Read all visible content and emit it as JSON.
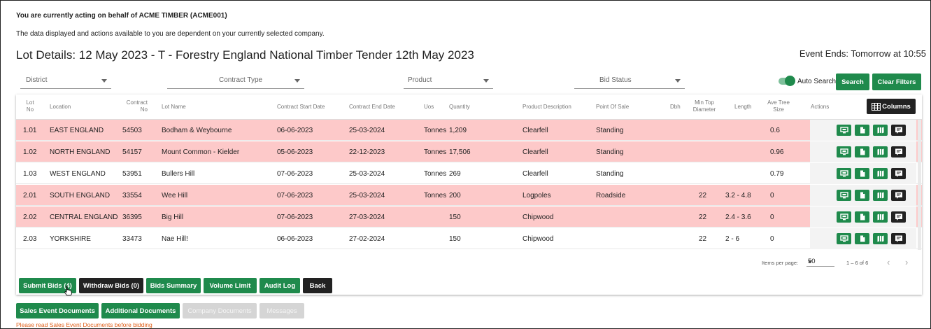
{
  "notice": {
    "acting_on_behalf": "You are currently acting on behalf of ACME TIMBER (ACME001)",
    "dependency": "The data displayed and actions available to you are dependent on your currently selected company."
  },
  "page": {
    "title": "Lot Details: 12 May 2023 - T - Forestry England National Timber Tender 12th May 2023",
    "event_ends": "Event Ends: Tomorrow at 10:55"
  },
  "filters": {
    "district": "District",
    "contract_type": "Contract Type",
    "product": "Product",
    "bid_status": "Bid Status",
    "auto_search_label": "Auto Search",
    "auto_search_on": true,
    "search_button": "Search",
    "clear_filters_button": "Clear Filters"
  },
  "table": {
    "headers": {
      "lot_no_1": "Lot",
      "lot_no_2": "No",
      "location": "Location",
      "contract_no_1": "Contract",
      "contract_no_2": "No",
      "lot_name": "Lot Name",
      "contract_start": "Contract Start Date",
      "contract_end": "Contract End Date",
      "uos": "Uos",
      "quantity": "Quantity",
      "product_description": "Product Description",
      "point_of_sale": "Point Of Sale",
      "dbh": "Dbh",
      "min_top_1": "Min Top",
      "min_top_2": "Diameter",
      "length": "Length",
      "ave_tree_1": "Ave Tree",
      "ave_tree_2": "Size",
      "actions": "Actions",
      "columns_button": "Columns"
    },
    "rows": [
      {
        "lot": "1.01",
        "location": "EAST ENGLAND",
        "contract": "54503",
        "name": "Bodham & Weybourne",
        "start": "06-06-2023",
        "end": "25-03-2024",
        "uos": "Tonnes",
        "qty": "1,209",
        "product": "Clearfell",
        "pos": "Standing",
        "dbh": "",
        "min_top": "",
        "length": "",
        "ave": "0.6",
        "highlight": true
      },
      {
        "lot": "1.02",
        "location": "NORTH ENGLAND",
        "contract": "54157",
        "name": "Mount Common - Kielder",
        "start": "05-06-2023",
        "end": "22-12-2023",
        "uos": "Tonnes",
        "qty": "17,506",
        "product": "Clearfell",
        "pos": "Standing",
        "dbh": "",
        "min_top": "",
        "length": "",
        "ave": "0.96",
        "highlight": true
      },
      {
        "lot": "1.03",
        "location": "WEST ENGLAND",
        "contract": "53951",
        "name": "Bullers Hill",
        "start": "07-06-2023",
        "end": "25-03-2024",
        "uos": "Tonnes",
        "qty": "269",
        "product": "Clearfell",
        "pos": "Standing",
        "dbh": "",
        "min_top": "",
        "length": "",
        "ave": "0.79",
        "highlight": false
      },
      {
        "lot": "2.01",
        "location": "SOUTH ENGLAND",
        "contract": "33554",
        "name": "Wee Hill",
        "start": "07-06-2023",
        "end": "25-03-2024",
        "uos": "Tonnes",
        "qty": "200",
        "product": "Logpoles",
        "pos": "Roadside",
        "dbh": "",
        "min_top": "22",
        "length": "3.2 - 4.8",
        "ave": "0",
        "highlight": true
      },
      {
        "lot": "2.02",
        "location": "CENTRAL ENGLAND",
        "contract": "36395",
        "name": "Big Hill",
        "start": "07-06-2023",
        "end": "27-03-2024",
        "uos": "",
        "qty": "150",
        "product": "Chipwood",
        "pos": "",
        "dbh": "",
        "min_top": "22",
        "length": "2.4 - 3.6",
        "ave": "0",
        "highlight": true
      },
      {
        "lot": "2.03",
        "location": "YORKSHIRE",
        "contract": "33473",
        "name": "Nae Hill!",
        "start": "06-06-2023",
        "end": "27-02-2024",
        "uos": "",
        "qty": "150",
        "product": "Chipwood",
        "pos": "",
        "dbh": "",
        "min_top": "22",
        "length": "2 - 6",
        "ave": "0",
        "highlight": false
      }
    ],
    "action_icons": [
      "screen-icon",
      "document-icon",
      "map-icon",
      "message-icon"
    ]
  },
  "pagination": {
    "items_per_page_label": "Items per page:",
    "items_per_page": "50",
    "range": "1 – 6 of 6",
    "prev": "‹",
    "next": "›"
  },
  "actions_bar": {
    "submit_bids": "Submit Bids (4)",
    "withdraw_bids": "Withdraw Bids (0)",
    "bids_summary": "Bids Summary",
    "volume_limit": "Volume Limit",
    "audit_log": "Audit Log",
    "back": "Back"
  },
  "documents": {
    "sales_event": "Sales Event Documents",
    "additional": "Additional Documents",
    "company": "Company Documents",
    "messages": "Messages",
    "warning": "Please read Sales Event Documents before bidding"
  },
  "colors": {
    "primary_green": "#1f8a4c",
    "dark": "#222222",
    "row_highlight": "#fdc9c9",
    "warning": "#e0611b"
  }
}
